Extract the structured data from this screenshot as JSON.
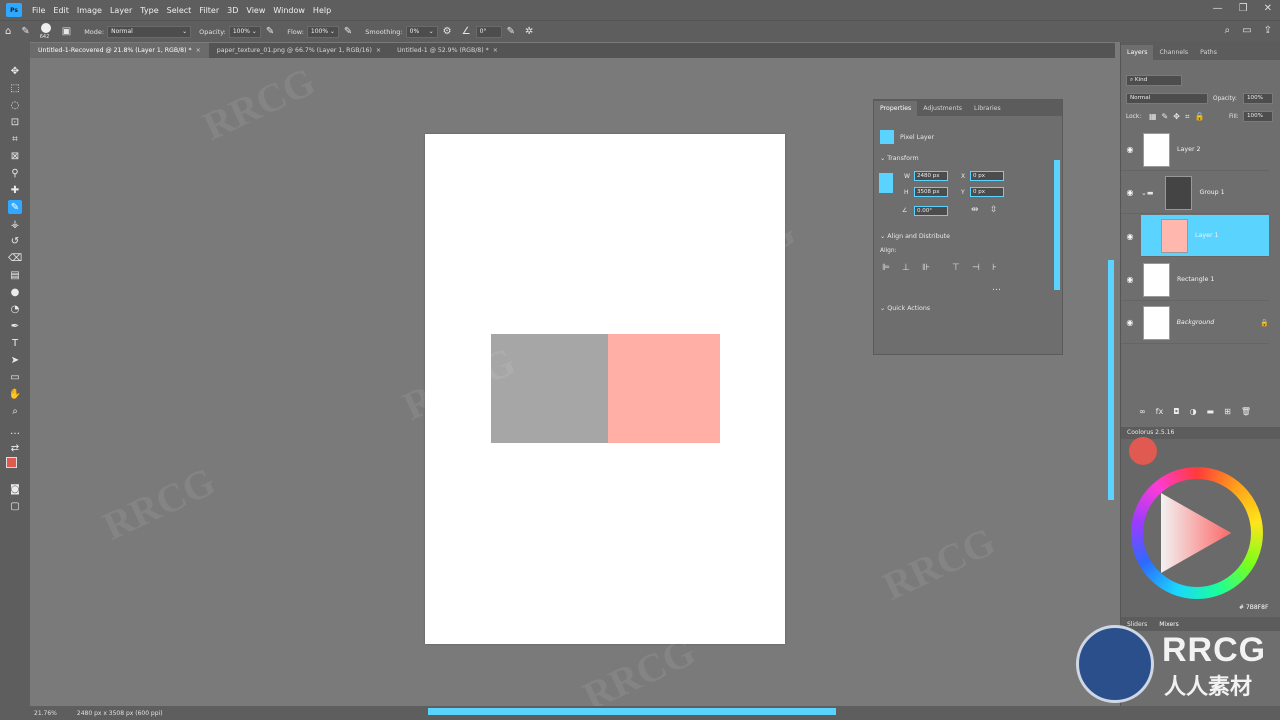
{
  "app": {
    "logo": "Ps"
  },
  "menu": [
    "File",
    "Edit",
    "Image",
    "Layer",
    "Type",
    "Select",
    "Filter",
    "3D",
    "View",
    "Window",
    "Help"
  ],
  "options": {
    "brush_size": "642",
    "mode_label": "Mode:",
    "mode_value": "Normal",
    "opacity_label": "Opacity:",
    "opacity_value": "100%",
    "flow_label": "Flow:",
    "flow_value": "100%",
    "smoothing_label": "Smoothing:",
    "smoothing_value": "0%",
    "angle_value": "0°"
  },
  "tabs": [
    {
      "label": "Untitled-1-Recovered @ 21.8% (Layer 1, RGB/8) *",
      "active": true
    },
    {
      "label": "paper_texture_01.png @ 66.7% (Layer 1, RGB/16)",
      "active": false
    },
    {
      "label": "Untitled-1 @ 52.9% (RGB/8) *",
      "active": false
    }
  ],
  "canvas": {
    "rect_colors": {
      "gray": "#a6a6a6",
      "pink": "#ffafa5"
    }
  },
  "properties": {
    "tabs": [
      "Properties",
      "Adjustments",
      "Libraries"
    ],
    "layer_type": "Pixel Layer",
    "transform_title": "Transform",
    "w_label": "W",
    "w_value": "2480 px",
    "h_label": "H",
    "h_value": "3508 px",
    "x_label": "X",
    "x_value": "0 px",
    "y_label": "Y",
    "y_value": "0 px",
    "angle_value": "0.00°",
    "align_title": "Align and Distribute",
    "align_label": "Align:",
    "quick_actions": "Quick Actions"
  },
  "layers_panel": {
    "tabs": [
      "Layers",
      "Channels",
      "Paths"
    ],
    "filter_kind": "Kind",
    "blend_mode": "Normal",
    "opacity_label": "Opacity:",
    "opacity_value": "100%",
    "lock_label": "Lock:",
    "fill_label": "Fill:",
    "fill_value": "100%",
    "layers": [
      {
        "name": "Layer 2",
        "selected": false
      },
      {
        "name": "Group 1",
        "selected": false
      },
      {
        "name": "Layer 1",
        "selected": true
      },
      {
        "name": "Rectangle 1",
        "selected": false
      },
      {
        "name": "Background",
        "selected": false
      }
    ]
  },
  "coloris": {
    "title": "Coolorus 2.5.16",
    "hex": "# 7B8F8F",
    "tabs": [
      "Sliders",
      "Mixers"
    ]
  },
  "status": {
    "zoom": "21.76%",
    "doc_info": "2480 px x 3508 px (600 ppi)"
  },
  "watermark": {
    "brand": "RRCG",
    "tagline": "人人素材",
    "faint": "RRCG"
  }
}
